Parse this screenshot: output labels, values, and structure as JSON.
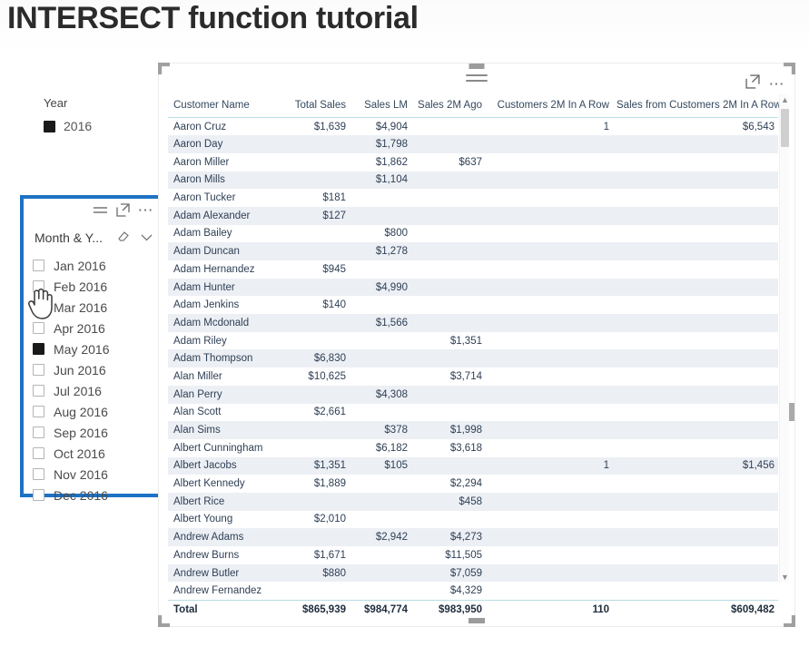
{
  "page": {
    "title": "INTERSECT function tutorial"
  },
  "year_slicer": {
    "name": "Year",
    "title": "Year",
    "options": [
      {
        "label": "2016",
        "checked": true
      }
    ]
  },
  "month_slicer": {
    "title": "Month & Y...",
    "header_icons": [
      "filter-menu-icon",
      "focus-mode-icon",
      "more-options-icon"
    ],
    "title_icons": [
      "eraser-clear-icon",
      "chevron-down-icon"
    ],
    "highlight_color": "#1d72c4",
    "options": [
      {
        "label": "Jan 2016",
        "checked": false
      },
      {
        "label": "Feb 2016",
        "checked": false
      },
      {
        "label": "Mar 2016",
        "checked": false
      },
      {
        "label": "Apr 2016",
        "checked": false
      },
      {
        "label": "May 2016",
        "checked": true
      },
      {
        "label": "Jun 2016",
        "checked": false
      },
      {
        "label": "Jul 2016",
        "checked": false
      },
      {
        "label": "Aug 2016",
        "checked": false
      },
      {
        "label": "Sep 2016",
        "checked": false
      },
      {
        "label": "Oct 2016",
        "checked": false
      },
      {
        "label": "Nov 2016",
        "checked": false
      },
      {
        "label": "Dec 2016",
        "checked": false
      }
    ]
  },
  "table_visual": {
    "header_icons": [
      "focus-mode-icon",
      "more-options-icon"
    ],
    "columns": [
      {
        "label": "Customer Name",
        "align": "left"
      },
      {
        "label": "Total Sales",
        "align": "right"
      },
      {
        "label": "Sales LM",
        "align": "right"
      },
      {
        "label": "Sales 2M Ago",
        "align": "right"
      },
      {
        "label": "Customers 2M In A Row",
        "align": "right"
      },
      {
        "label": "Sales from Customers 2M In A Row",
        "align": "right"
      }
    ],
    "rows": [
      [
        "Aaron Cruz",
        "$1,639",
        "$4,904",
        "",
        "1",
        "$6,543"
      ],
      [
        "Aaron Day",
        "",
        "$1,798",
        "",
        "",
        ""
      ],
      [
        "Aaron Miller",
        "",
        "$1,862",
        "$637",
        "",
        ""
      ],
      [
        "Aaron Mills",
        "",
        "$1,104",
        "",
        "",
        ""
      ],
      [
        "Aaron Tucker",
        "$181",
        "",
        "",
        "",
        ""
      ],
      [
        "Adam Alexander",
        "$127",
        "",
        "",
        "",
        ""
      ],
      [
        "Adam Bailey",
        "",
        "$800",
        "",
        "",
        ""
      ],
      [
        "Adam Duncan",
        "",
        "$1,278",
        "",
        "",
        ""
      ],
      [
        "Adam Hernandez",
        "$945",
        "",
        "",
        "",
        ""
      ],
      [
        "Adam Hunter",
        "",
        "$4,990",
        "",
        "",
        ""
      ],
      [
        "Adam Jenkins",
        "$140",
        "",
        "",
        "",
        ""
      ],
      [
        "Adam Mcdonald",
        "",
        "$1,566",
        "",
        "",
        ""
      ],
      [
        "Adam Riley",
        "",
        "",
        "$1,351",
        "",
        ""
      ],
      [
        "Adam Thompson",
        "$6,830",
        "",
        "",
        "",
        ""
      ],
      [
        "Alan Miller",
        "$10,625",
        "",
        "$3,714",
        "",
        ""
      ],
      [
        "Alan Perry",
        "",
        "$4,308",
        "",
        "",
        ""
      ],
      [
        "Alan Scott",
        "$2,661",
        "",
        "",
        "",
        ""
      ],
      [
        "Alan Sims",
        "",
        "$378",
        "$1,998",
        "",
        ""
      ],
      [
        "Albert Cunningham",
        "",
        "$6,182",
        "$3,618",
        "",
        ""
      ],
      [
        "Albert Jacobs",
        "$1,351",
        "$105",
        "",
        "1",
        "$1,456"
      ],
      [
        "Albert Kennedy",
        "$1,889",
        "",
        "$2,294",
        "",
        ""
      ],
      [
        "Albert Rice",
        "",
        "",
        "$458",
        "",
        ""
      ],
      [
        "Albert Young",
        "$2,010",
        "",
        "",
        "",
        ""
      ],
      [
        "Andrew Adams",
        "",
        "$2,942",
        "$4,273",
        "",
        ""
      ],
      [
        "Andrew Burns",
        "$1,671",
        "",
        "$11,505",
        "",
        ""
      ],
      [
        "Andrew Butler",
        "$880",
        "",
        "$7,059",
        "",
        ""
      ],
      [
        "Andrew Fernandez",
        "",
        "",
        "$4,329",
        "",
        ""
      ]
    ],
    "total_row": [
      "Total",
      "$865,939",
      "$984,774",
      "$983,950",
      "110",
      "$609,482"
    ]
  }
}
